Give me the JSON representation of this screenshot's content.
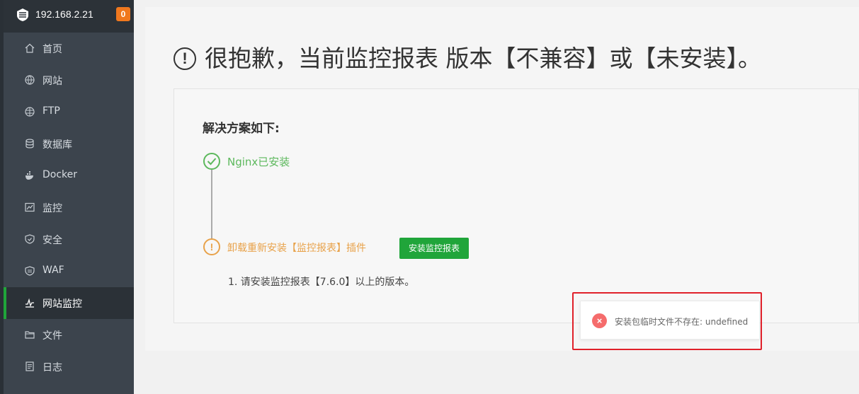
{
  "server": {
    "ip": "192.168.2.21",
    "badge_count": "0"
  },
  "sidebar": {
    "items": [
      {
        "label": "首页",
        "icon": "home-icon"
      },
      {
        "label": "网站",
        "icon": "globe-icon"
      },
      {
        "label": "FTP",
        "icon": "ftp-icon"
      },
      {
        "label": "数据库",
        "icon": "database-icon"
      },
      {
        "label": "Docker",
        "icon": "docker-icon"
      },
      {
        "label": "监控",
        "icon": "monitor-icon"
      },
      {
        "label": "安全",
        "icon": "shield-icon"
      },
      {
        "label": "WAF",
        "icon": "waf-icon"
      },
      {
        "label": "网站监控",
        "icon": "site-monitor-icon",
        "active": true
      },
      {
        "label": "文件",
        "icon": "folder-icon"
      },
      {
        "label": "日志",
        "icon": "log-icon"
      }
    ]
  },
  "main": {
    "warning_symbol": "!",
    "headline": "很抱歉，当前监控报表 版本【不兼容】或【未安装】。",
    "solution_title": "解决方案如下:",
    "steps": [
      {
        "label": "Nginx已安装",
        "status": "done"
      },
      {
        "label": "卸载重新安装【监控报表】插件",
        "status": "warning",
        "symbol": "!"
      }
    ],
    "install_button": "安装监控报表",
    "note": "1. 请安装监控报表【7.6.0】以上的版本。"
  },
  "toast": {
    "symbol": "×",
    "message": "安装包临时文件不存在: undefined"
  },
  "colors": {
    "accent": "#20a53a",
    "warning": "#e8a24a",
    "success": "#5cb85c",
    "error": "#f56c6c",
    "highlight": "#e0202a"
  }
}
